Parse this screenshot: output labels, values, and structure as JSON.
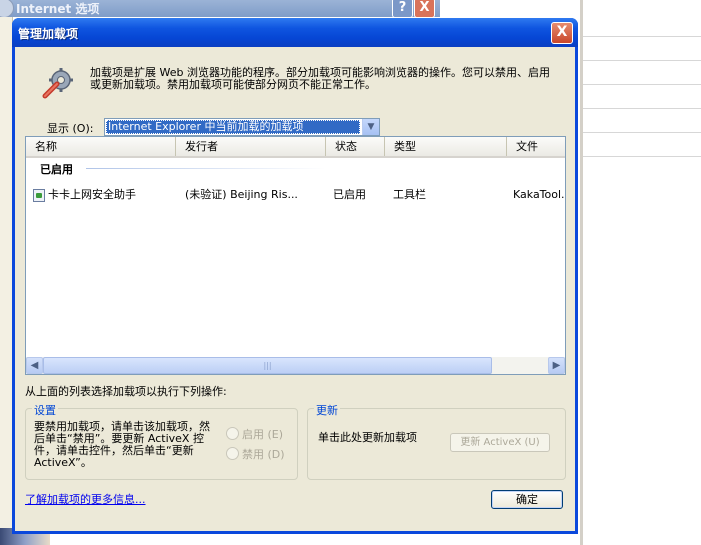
{
  "background_window": {
    "title": "Internet 选项",
    "help_label": "?",
    "close_label": "X"
  },
  "dialog": {
    "title": "管理加载项",
    "close_label": "X",
    "description": "加载项是扩展 Web 浏览器功能的程序。部分加载项可能影响浏览器的操作。您可以禁用、启用或更新加载项。禁用加载项可能使部分网页不能正常工作。",
    "show_label": "显示 (O):",
    "show_value": "Internet Explorer 中当前加载的加载项",
    "list": {
      "columns": [
        "名称",
        "发行者",
        "状态",
        "类型",
        "文件"
      ],
      "group_title": "已启用",
      "rows": [
        {
          "name": "卡卡上网安全助手",
          "publisher": "(未验证) Beijing Ris...",
          "status": "已启用",
          "type": "工具栏",
          "file": "KakaTool..."
        }
      ],
      "scroll_thumb_grip": "|||"
    },
    "instructions": "从上面的列表选择加载项以执行下列操作:",
    "settings": {
      "legend": "设置",
      "text": "要禁用加载项，请单击该加载项，然后单击“禁用”。要更新 ActiveX 控件，请单击控件，然后单击“更新 ActiveX”。",
      "enable_label": "启用 (E)",
      "disable_label": "禁用 (D)"
    },
    "update": {
      "legend": "更新",
      "text": "单击此处更新加载项",
      "button_label": "更新 ActiveX (U)"
    },
    "more_info_link": "了解加载项的更多信息...",
    "ok_label": "确定"
  }
}
